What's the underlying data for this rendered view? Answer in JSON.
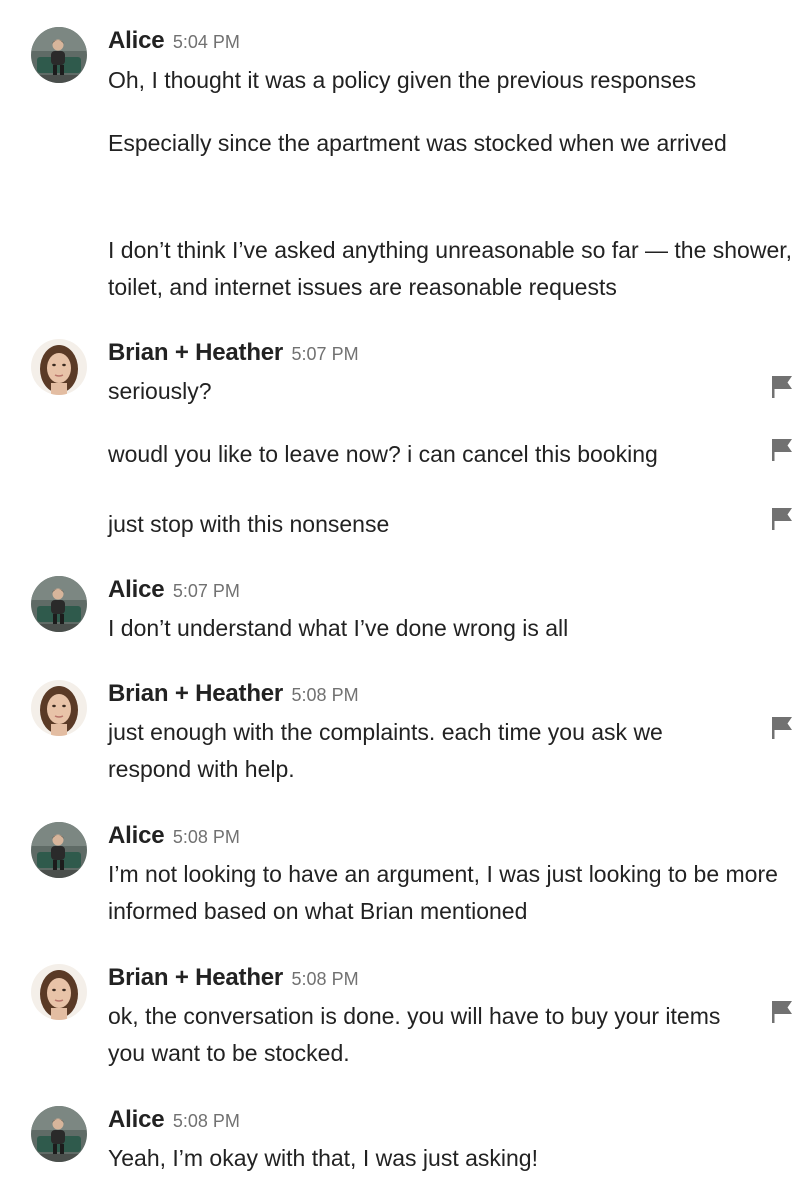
{
  "participants": {
    "alice": {
      "name": "Alice"
    },
    "hosts": {
      "name": "Brian + Heather"
    }
  },
  "groups": [
    {
      "sender": "Alice",
      "time": "5:04 PM",
      "messages": [
        "Oh, I thought it was a policy given the previous responses",
        "Especially since the apartment was stocked when we arrived",
        "I don’t think I’ve asked anything unreasonable so far — the shower, toilet, and internet issues are reasonable requests"
      ]
    },
    {
      "sender": "Brian + Heather",
      "time": "5:07 PM",
      "messages": [
        "seriously?",
        "woudl you like to leave now? i can cancel this booking",
        "just stop with this nonsense"
      ]
    },
    {
      "sender": "Alice",
      "time": "5:07 PM",
      "messages": [
        "I don’t understand what I’ve done wrong is all"
      ]
    },
    {
      "sender": "Brian + Heather",
      "time": "5:08 PM",
      "messages": [
        "just enough with the complaints. each time you ask we respond with help."
      ]
    },
    {
      "sender": "Alice",
      "time": "5:08 PM",
      "messages": [
        "I’m not looking to have an argument, I was just looking to be more informed based on what Brian mentioned"
      ]
    },
    {
      "sender": "Brian + Heather",
      "time": "5:08 PM",
      "messages": [
        "ok, the conversation is done. you will have to buy your items you want to be stocked."
      ]
    },
    {
      "sender": "Alice",
      "time": "5:08 PM",
      "messages": [
        "Yeah, I’m okay with that, I was just asking!"
      ]
    }
  ],
  "icons": {
    "report": "flag-icon",
    "alice_avatar": "alice-avatar",
    "host_avatar": "host-avatar"
  },
  "colors": {
    "text": "#222222",
    "timestamp": "#717171",
    "flag": "#717171",
    "background": "#ffffff"
  }
}
